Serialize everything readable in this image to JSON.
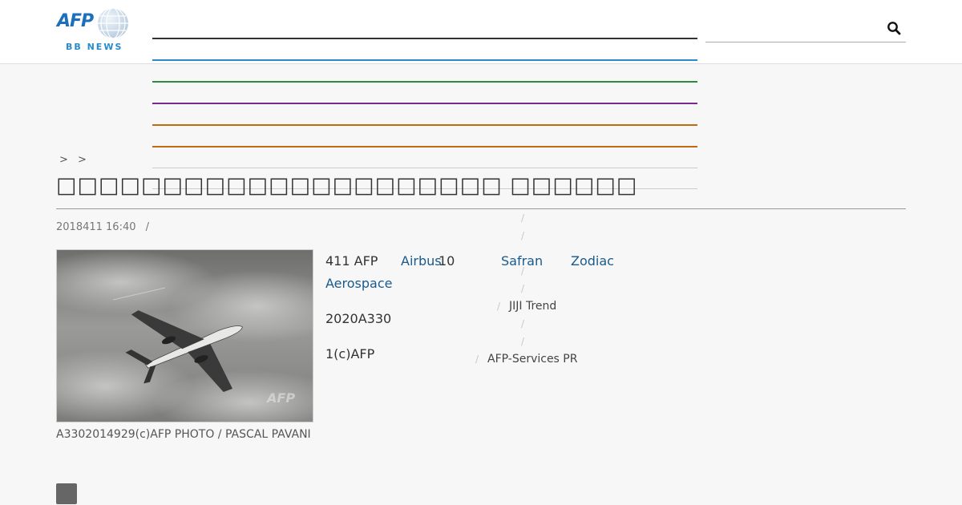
{
  "logo": {
    "brand": "AFP",
    "sub": "BB NEWS"
  },
  "search": {
    "value": "",
    "placeholder": ""
  },
  "menu_colors": [
    "#333333",
    "#2a89c6",
    "#2e8b3e",
    "#7a2a8a",
    "#c06a14",
    "#c06a14",
    "#cccccc",
    "#cccccc"
  ],
  "breadcrumb": [
    ">",
    ">"
  ],
  "article": {
    "title": "□□□□□□□□□□□□□□□□□□□□□ □□□□□□",
    "date": "2018411 16:40",
    "date_sep": "/",
    "photo_watermark": "AFP",
    "caption": "A3302014929(c)AFP PHOTO / PASCAL PAVANI",
    "para1": "411 AFP",
    "para2": "2020A330",
    "para3": "1(c)AFP",
    "links": {
      "airbus": "Airbus",
      "safran": "Safran",
      "zodiac": "Zodiac",
      "aerospace": "Aerospace"
    },
    "airbus_suffix": "10"
  },
  "sidebar": {
    "slash": "/",
    "jiji": "JIJI Trend",
    "afp_services": "AFP-Services PR"
  },
  "icons": {
    "search": "search-icon",
    "globe": "globe-icon",
    "widget": "gray-square-icon"
  }
}
